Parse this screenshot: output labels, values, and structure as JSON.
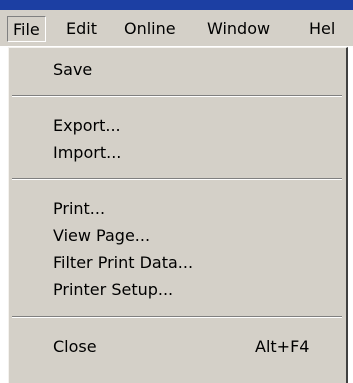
{
  "menubar": {
    "items": [
      {
        "label": "File"
      },
      {
        "label": "Edit"
      },
      {
        "label": "Online"
      },
      {
        "label": "Window"
      },
      {
        "label": "Hel"
      }
    ],
    "active": "File"
  },
  "file_menu": {
    "items": [
      {
        "label": "Save"
      },
      {
        "label": "Export..."
      },
      {
        "label": "Import..."
      },
      {
        "label": "Print..."
      },
      {
        "label": "View Page..."
      },
      {
        "label": "Filter Print Data..."
      },
      {
        "label": "Printer Setup..."
      },
      {
        "label": "Close",
        "shortcut": "Alt+F4"
      }
    ]
  },
  "colors": {
    "menu_background": "#d4d0c8",
    "titlebar": "#1c3fa3"
  }
}
